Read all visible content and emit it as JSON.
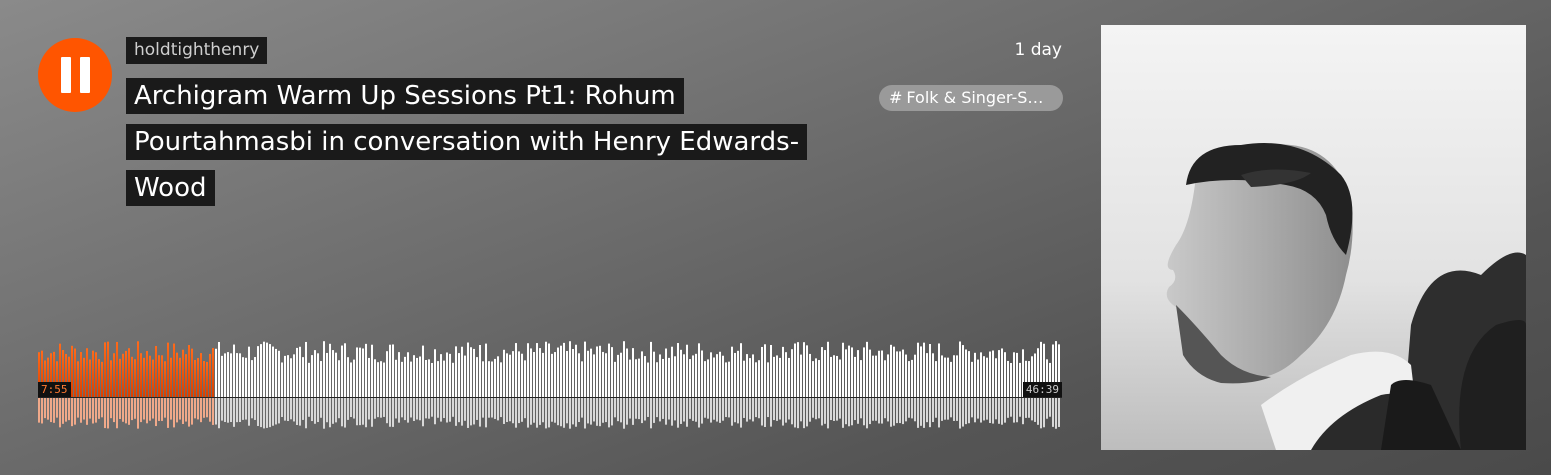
{
  "track": {
    "username": "holdtighthenry",
    "title": "Archigram Warm Up Sessions Pt1: Rohum Pourtahmasbi in conversation with Henry Edwards-Wood",
    "time_ago": "1 day",
    "tag": "Folk & Singer-S…",
    "tag_icon": "hash-icon"
  },
  "player": {
    "state": "playing",
    "control_icon": "pause-icon",
    "current_time": "7:55",
    "total_time": "46:39",
    "progress": 0.17,
    "accent_color": "#ff5500"
  },
  "artwork": {
    "kind": "photo",
    "subject": "black-and-white profile portrait of a man"
  }
}
